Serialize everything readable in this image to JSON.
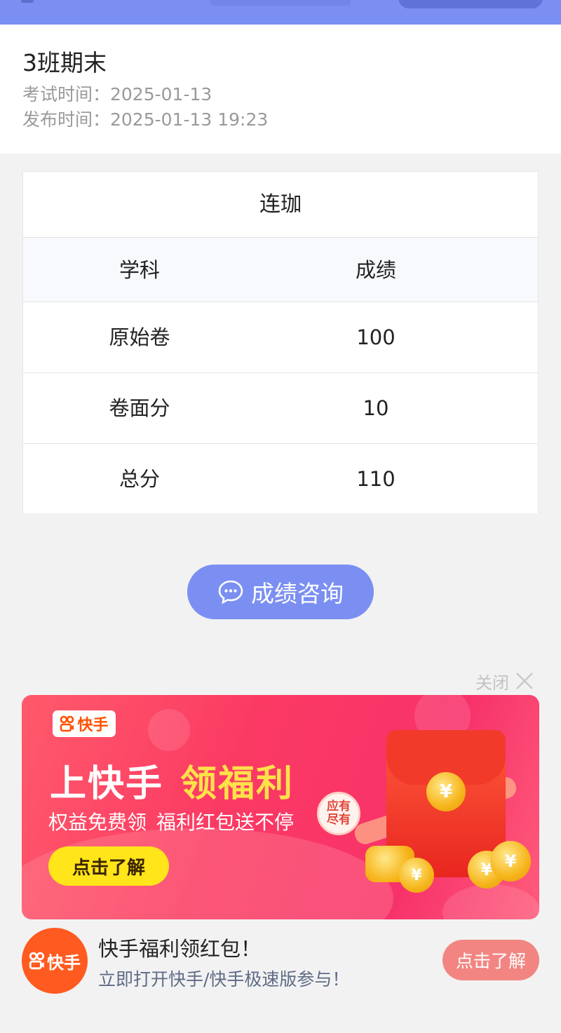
{
  "colors": {
    "accent": "#7b8ff2",
    "ad_red": "#f7326a",
    "kuaishou_orange": "#ff5a1f",
    "cta_yellow": "#ffe51a"
  },
  "exam": {
    "title": "3班期末",
    "exam_time": "考试时间：2025-01-13",
    "publish_time": "发布时间：2025-01-13 19:23"
  },
  "score_card": {
    "student_name": "连珈",
    "columns": [
      "学科",
      "成绩"
    ],
    "rows": [
      {
        "subject": "原始卷",
        "score": "100"
      },
      {
        "subject": "卷面分",
        "score": "10"
      },
      {
        "subject": "总分",
        "score": "110"
      }
    ]
  },
  "consult": {
    "label": "成绩咨询",
    "icon": "chat-bubble-icon"
  },
  "ad": {
    "close_label": "关闭",
    "brand": "快手",
    "headline_white": "上快手",
    "headline_yellow": "领福利",
    "sub_part1": "权益免费领",
    "sub_part2": "福利红包送不停",
    "badge_line1": "应有",
    "badge_line2": "尽有",
    "banner_button": "点击了解",
    "footer_brand": "快手",
    "footer_title": "快手福利领红包！",
    "footer_subtitle": "立即打开快手/快手极速版参与！",
    "footer_button": "点击了解"
  }
}
